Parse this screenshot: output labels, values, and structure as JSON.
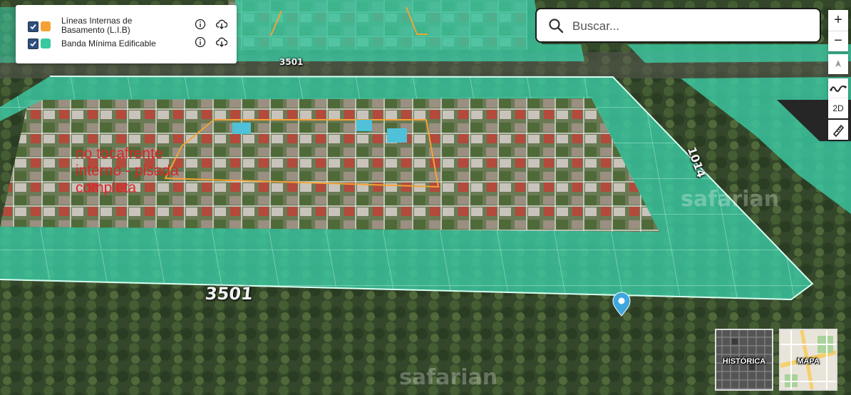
{
  "legend": {
    "items": [
      {
        "label_line1": "Líneas Internas de",
        "label_line2": "Basamento (L.I.B)",
        "color": "#f4a236",
        "checked": true
      },
      {
        "label_line1": "Banda Mínima Edificable",
        "label_line2": "",
        "color": "#39c8a0",
        "checked": true
      }
    ],
    "info_icon": "info-icon",
    "download_icon": "cloud-download-icon"
  },
  "search": {
    "placeholder": "Buscar...",
    "value": "",
    "icon": "search-icon"
  },
  "controls": {
    "zoom_in": "+",
    "zoom_out": "−",
    "compass_icon": "compass-icon",
    "terrain_icon": "terrain-profile-icon",
    "view_mode": "2D",
    "measure_icon": "ruler-icon"
  },
  "map": {
    "street_number_top": "3501",
    "street_number_bottom": "3501",
    "street_number_right": "1014",
    "annotation": [
      "no tocafrente",
      "interno - pisada",
      "completa"
    ],
    "watermark": "safarian",
    "marker_icon": "location-pin-icon"
  },
  "basemaps": [
    {
      "label": "HISTÓRICA"
    },
    {
      "label": "MAPA"
    }
  ]
}
